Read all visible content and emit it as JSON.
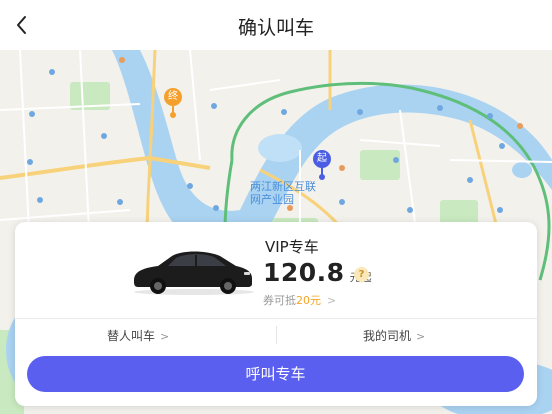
{
  "nav": {
    "title": "确认叫车",
    "back_icon": "chevron-left-icon"
  },
  "map": {
    "start_pin": "起",
    "end_pin": "终",
    "area_label": "两江新区互联网产业园",
    "colors": {
      "river": "#aad3f2",
      "park": "#c9e9c0",
      "road_major": "#f7d27a",
      "pin_start": "#4a5de3",
      "pin_end": "#f5a02c"
    }
  },
  "card": {
    "service_name": "VIP专车",
    "price": "120.8",
    "price_unit": "元起",
    "help_icon": "?",
    "coupon_text": "券可抵",
    "coupon_amount": "20元",
    "coupon_arrow": ">",
    "option_left": "替人叫车",
    "option_right": "我的司机",
    "option_arrow": ">"
  },
  "action": {
    "call_label": "呼叫专车",
    "color": "#5b5ff0"
  }
}
